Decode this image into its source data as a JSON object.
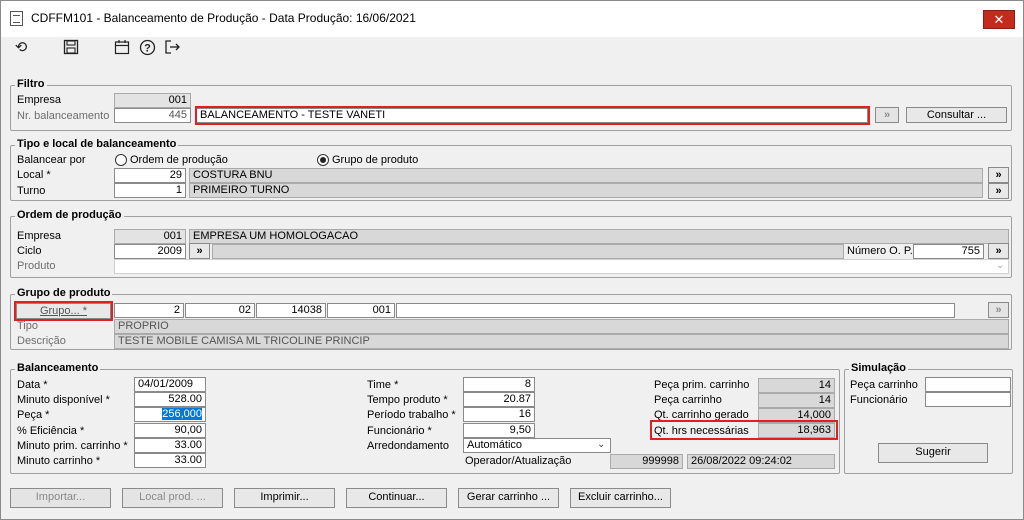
{
  "window": {
    "title": "CDFFM101 - Balanceamento de Produção - Data Produção:  16/06/2021",
    "close": "✕"
  },
  "toolbar": {
    "refresh": "⟲",
    "save": "▣",
    "calendar": "▦",
    "help": "?",
    "exit": "⇥"
  },
  "filtro": {
    "legend": "Filtro",
    "empresa_label": "Empresa",
    "empresa_value": "001",
    "nr_label": "Nr. balanceamento",
    "nr_value": "445",
    "descricao_value": "BALANCEAMENTO - TESTE VANETI",
    "small_btn": "»",
    "consultar": "Consultar ..."
  },
  "tipo": {
    "legend": "Tipo e local de balanceamento",
    "balancear_label": "Balancear por",
    "radio_ordem": "Ordem de produção",
    "radio_grupo": "Grupo de produto",
    "local_label": "Local *",
    "local_code": "29",
    "local_name": "COSTURA BNU",
    "turno_label": "Turno",
    "turno_code": "1",
    "turno_name": "PRIMEIRO TURNO",
    "arrow": "»"
  },
  "ordem": {
    "legend": "Ordem de produção",
    "empresa_label": "Empresa",
    "empresa_code": "001",
    "empresa_name": "EMPRESA UM HOMOLOGACAO",
    "ciclo_label": "Ciclo",
    "ciclo_value": "2009",
    "numero_label": "Número O. P.",
    "numero_value": "755",
    "produto_label": "Produto",
    "arrow": "»"
  },
  "grupo": {
    "legend": "Grupo de produto",
    "grupo_btn": "Grupo... *",
    "g1": "2",
    "g2": "02",
    "g3": "14038",
    "g4": "001",
    "tipo_label": "Tipo",
    "tipo_value": "PROPRIO",
    "descricao_label": "Descrição",
    "descricao_value": "TESTE MOBILE CAMISA ML TRICOLINE PRINCIP",
    "small_btn": "»"
  },
  "balanceamento": {
    "legend": "Balanceamento",
    "data_label": "Data *",
    "data_value": "04/01/2009",
    "minuto_disp_label": "Minuto disponível *",
    "minuto_disp_value": "528.00",
    "peca_label": "Peça *",
    "peca_value": "256,000",
    "eficiencia_label": "% Eficiência *",
    "eficiencia_value": "90,00",
    "min_prim_label": "Minuto prim. carrinho *",
    "min_prim_value": "33.00",
    "min_carr_label": "Minuto carrinho *",
    "min_carr_value": "33.00",
    "time_label": "Time *",
    "time_value": "8",
    "tempo_label": "Tempo produto *",
    "tempo_value": "20.87",
    "periodo_label": "Período trabalho *",
    "periodo_value": "16",
    "funcionario_label": "Funcionário *",
    "funcionario_value": "9,50",
    "arred_label": "Arredondamento",
    "arred_value": "Automático",
    "operador_label": "Operador/Atualização",
    "operador_value": "999998",
    "operador_data": "26/08/2022 09:24:02",
    "peca_prim_label": "Peça prim. carrinho",
    "peca_prim_value": "14",
    "peca_carr_label": "Peça carrinho",
    "peca_carr_value": "14",
    "qt_gerado_label": "Qt. carrinho gerado",
    "qt_gerado_value": "14,000",
    "qt_hrs_label": "Qt. hrs necessárias",
    "qt_hrs_value": "18,963"
  },
  "simulacao": {
    "legend": "Simulação",
    "peca_label": "Peça carrinho",
    "funcionario_label": "Funcionário",
    "sugerir": "Sugerir"
  },
  "bottom": {
    "importar": "Importar...",
    "local_prod": "Local prod. ...",
    "imprimir": "Imprimir...",
    "continuar": "Continuar...",
    "gerar": "Gerar carrinho ...",
    "excluir": "Excluir carrinho..."
  }
}
